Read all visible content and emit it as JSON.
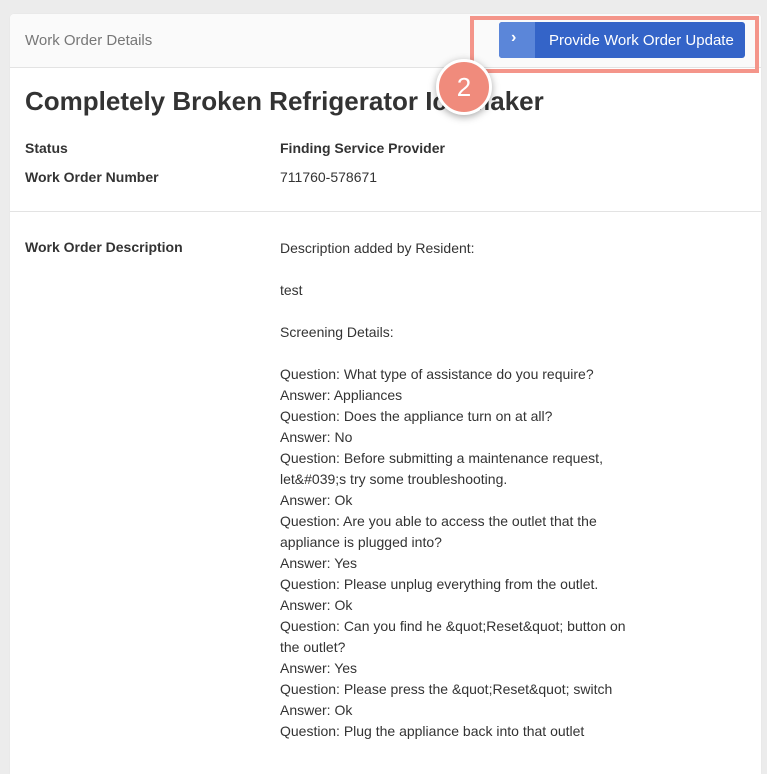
{
  "header": {
    "title": "Work Order Details",
    "update_button_label": "Provide Work Order Update",
    "update_button_icon": "chevron-right-icon"
  },
  "annotation": {
    "step_number": "2",
    "color": "#f08b7c"
  },
  "work_order": {
    "title": "Completely Broken Refrigerator Ice Maker",
    "status_label": "Status",
    "status_value": "Finding Service Provider",
    "number_label": "Work Order Number",
    "number_value": "711760-578671",
    "description_label": "Work Order Description",
    "description": {
      "intro": "Description added by Resident:",
      "resident_text": "test",
      "screening_heading": "Screening Details:",
      "lines": [
        "Question: What type of assistance do you require?",
        "Answer: Appliances",
        "Question: Does the appliance turn on at all?",
        "Answer: No",
        "Question: Before submitting a maintenance request, let&#039;s try some troubleshooting.",
        "Answer: Ok",
        "Question: Are you able to access the outlet that the appliance is plugged into?",
        "Answer: Yes",
        "Question: Please unplug everything from the outlet.",
        "Answer: Ok",
        "Question: Can you find he &quot;Reset&quot; button on the outlet?",
        "Answer: Yes",
        "Question: Please press the &quot;Reset&quot; switch",
        "Answer: Ok",
        "Question: Plug the appliance back into that outlet"
      ]
    }
  },
  "colors": {
    "primary_button": "#3464c8",
    "highlight": "#f4958a",
    "background": "#ececec"
  }
}
